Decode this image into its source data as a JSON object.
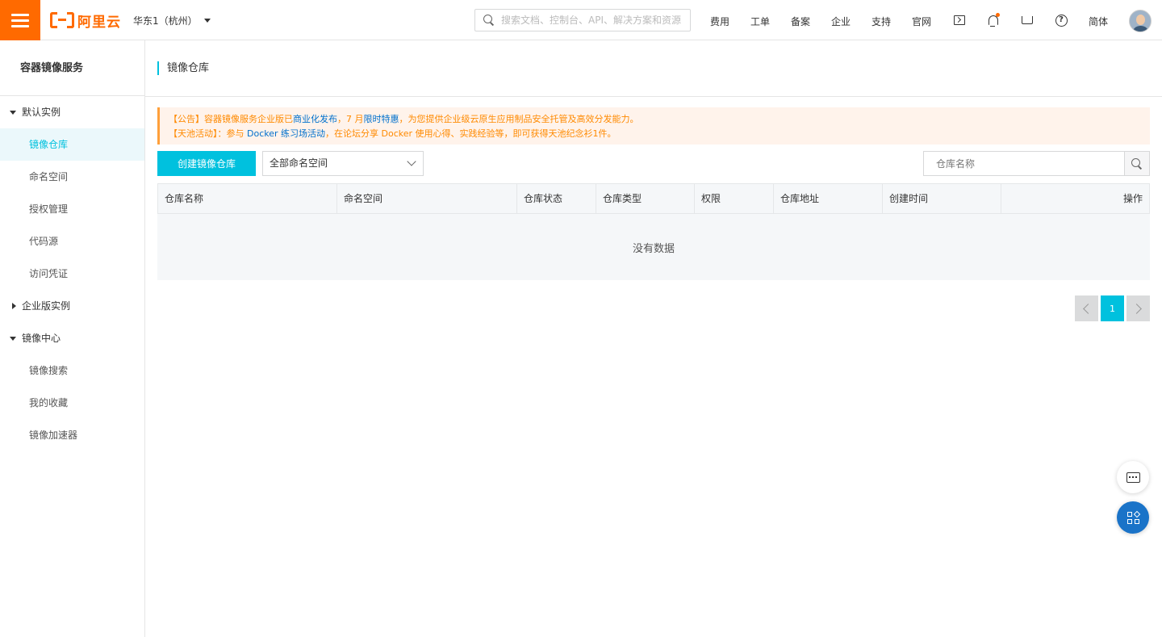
{
  "topbar": {
    "logo_text": "阿里云",
    "region": "华东1（杭州）",
    "search_placeholder": "搜索文档、控制台、API、解决方案和资源",
    "nav": [
      "费用",
      "工单",
      "备案",
      "企业",
      "支持",
      "官网"
    ],
    "icons": [
      "terminal-icon",
      "bell-icon",
      "cart-icon",
      "help-icon"
    ],
    "lang": "简体"
  },
  "sidebar": {
    "title": "容器镜像服务",
    "groups": [
      {
        "label": "默认实例",
        "expanded": true,
        "items": [
          "镜像仓库",
          "命名空间",
          "授权管理",
          "代码源",
          "访问凭证"
        ]
      },
      {
        "label": "企业版实例",
        "expanded": false,
        "items": []
      },
      {
        "label": "镜像中心",
        "expanded": true,
        "items": [
          "镜像搜索",
          "我的收藏",
          "镜像加速器"
        ]
      }
    ],
    "active_item": "镜像仓库"
  },
  "page": {
    "title": "镜像仓库"
  },
  "notice": {
    "line1_prefix": "【公告】容器镜像服务企业版已",
    "line1_link1": "商业化发布",
    "line1_mid": "，7 月",
    "line1_link2": "限时特惠",
    "line1_suffix": "，为您提供企业级云原生应用制品安全托管及高效分发能力。",
    "line2_prefix": "【天池活动】：参与 ",
    "line2_link": "Docker 练习场活动",
    "line2_suffix": "，在论坛分享 Docker 使用心得、实践经验等，即可获得天池纪念衫1件。"
  },
  "toolbar": {
    "create_label": "创建镜像仓库",
    "namespace_select": "全部命名空间",
    "filter_placeholder": "仓库名称"
  },
  "table": {
    "columns": [
      "仓库名称",
      "命名空间",
      "仓库状态",
      "仓库类型",
      "权限",
      "仓库地址",
      "创建时间",
      "操作"
    ],
    "empty_text": "没有数据"
  },
  "pagination": {
    "current_page": "1"
  },
  "colors": {
    "brand": "#ff6a00",
    "accent": "#00c1de",
    "notice_text": "#ff8a00",
    "link": "#0070cc"
  }
}
